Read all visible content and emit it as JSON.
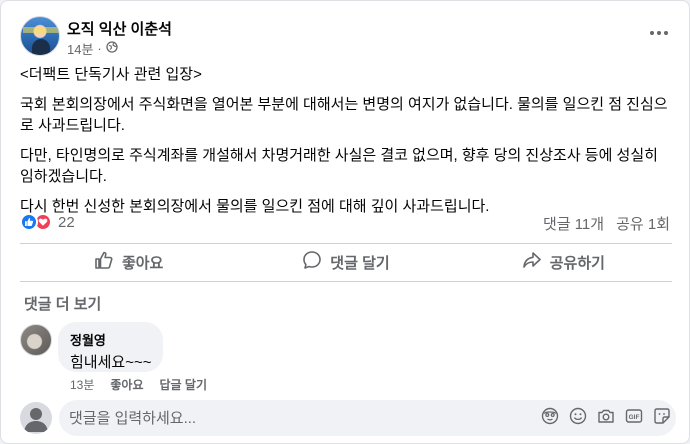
{
  "post": {
    "author": "오직 익산 이춘석",
    "time": "14분",
    "privacy_icon": "globe-icon",
    "paragraphs": [
      "<더팩트 단독기사 관련 입장>",
      "국회 본회의장에서 주식화면을 열어본 부분에 대해서는 변명의 여지가 없습니다. 물의를 일으킨 점 진심으로 사과드립니다.",
      "다만, 타인명의로 주식계좌를 개설해서 차명거래한 사실은 결코 없으며, 향후 당의 진상조사 등에 성실히 임하겠습니다.",
      "다시 한번 신성한 본회의장에서 물의를 일으킨 점에 대해 깊이 사과드립니다."
    ]
  },
  "stats": {
    "reaction_count": "22",
    "comments": "댓글 11개",
    "shares": "공유 1회"
  },
  "actions": {
    "like": "좋아요",
    "comment": "댓글 달기",
    "share": "공유하기"
  },
  "comments": {
    "more_label": "댓글 더 보기",
    "items": [
      {
        "author": "정월영",
        "text": "힘내세요~~~",
        "time": "13분",
        "like": "좋아요",
        "reply": "답글 달기"
      }
    ]
  },
  "composer": {
    "placeholder": "댓글을 입력하세요...",
    "icons": [
      "avatar-sticker-icon",
      "emoji-icon",
      "camera-icon",
      "gif-icon",
      "sticker-icon"
    ]
  },
  "colors": {
    "text_primary": "#050505",
    "text_secondary": "#65676b",
    "like_blue": "#1877f2",
    "love_red": "#f33e58",
    "surface": "#f0f2f5"
  }
}
